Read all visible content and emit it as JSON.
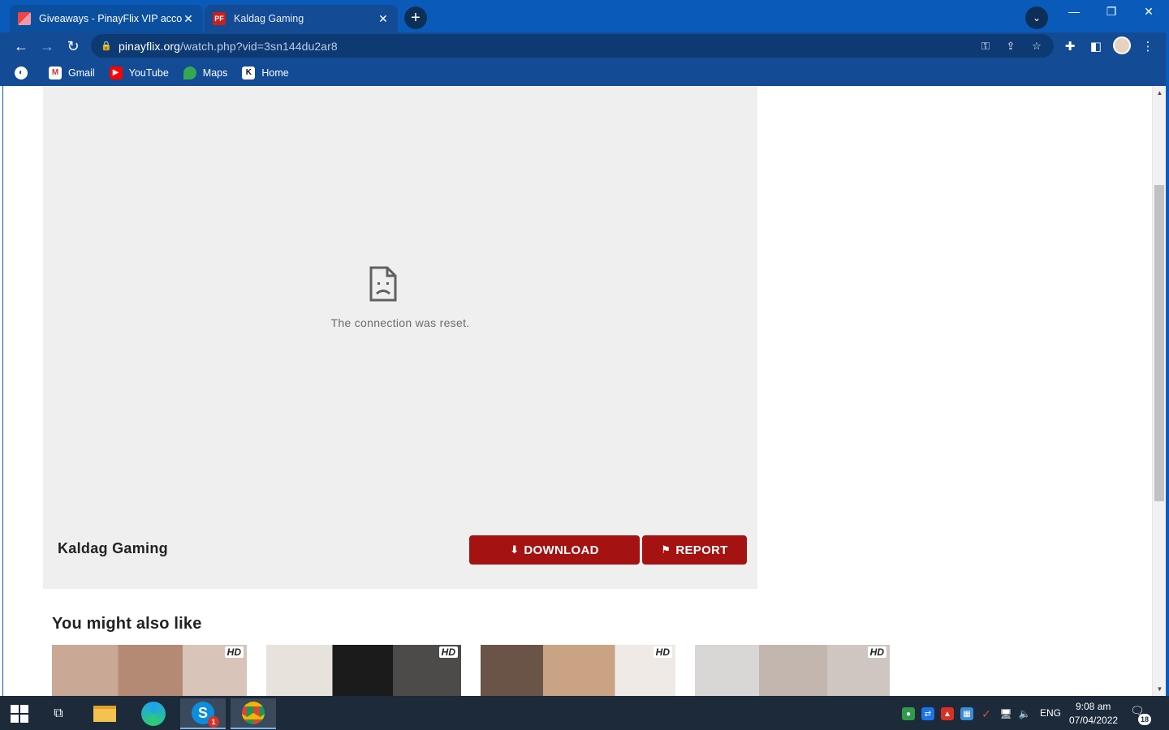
{
  "tabs": [
    {
      "title": "Giveaways - PinayFlix VIP accoun",
      "favicon": "gift-icon",
      "active": false
    },
    {
      "title": "Kaldag Gaming",
      "favicon": "pf-logo-icon",
      "active": true
    }
  ],
  "toolbar": {
    "url_host": "pinayflix.org",
    "url_path": "/watch.php?vid=3sn144du2ar8"
  },
  "bookmarks": [
    {
      "label": "Gmail",
      "icon": "gmail-icon"
    },
    {
      "label": "YouTube",
      "icon": "youtube-icon"
    },
    {
      "label": "Maps",
      "icon": "maps-icon"
    },
    {
      "label": "Home",
      "icon": "k-logo-icon"
    }
  ],
  "player": {
    "error_message": "The connection was reset."
  },
  "video": {
    "title": "Kaldag Gaming",
    "download_label": "DOWNLOAD",
    "report_label": "REPORT"
  },
  "related": {
    "heading": "You might also like",
    "badge": "HD",
    "thumbnails": [
      {
        "badge": "HD"
      },
      {
        "badge": "HD"
      },
      {
        "badge": "HD"
      },
      {
        "badge": "HD"
      }
    ]
  },
  "taskbar": {
    "language": "ENG",
    "time": "9:08 am",
    "date": "07/04/2022",
    "skype_badge": "1",
    "notification_count": "18"
  },
  "colors": {
    "chrome_blue": "#0a5bb9",
    "toolbar_blue": "#134b94",
    "button_red": "#a51212",
    "player_bg": "#efefef"
  }
}
